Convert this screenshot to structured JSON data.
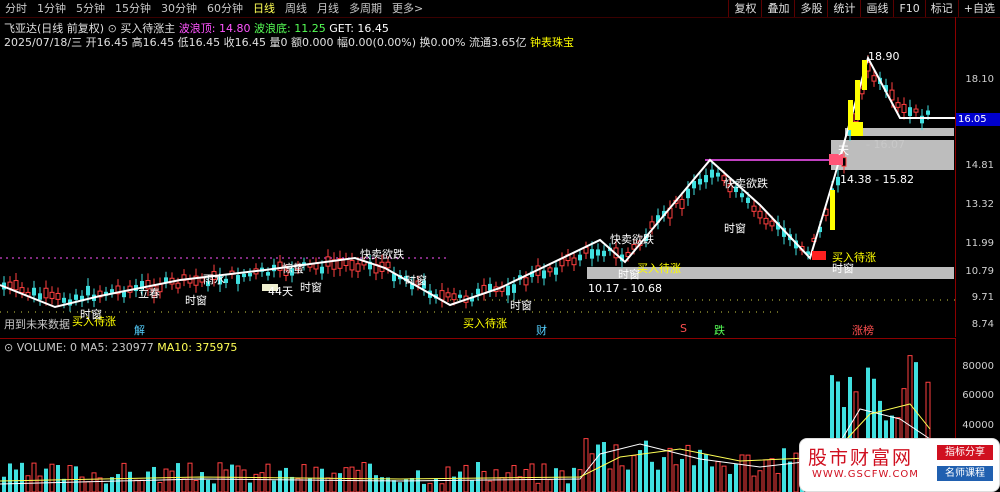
{
  "toolbar": {
    "periods": [
      "分时",
      "1分钟",
      "5分钟",
      "15分钟",
      "30分钟",
      "60分钟",
      "日线",
      "周线",
      "月线",
      "多周期",
      "更多>"
    ],
    "active_period": "日线",
    "right_buttons": [
      "复权",
      "叠加",
      "多股",
      "统计",
      "画线",
      "F10",
      "标记",
      "+自选"
    ]
  },
  "header": {
    "stock_name": "飞亚达(日线 前复权)",
    "indicator_name": "买入待涨主",
    "peak_label": "波浪顶: 14.80",
    "trough_label": "波浪底: 11.25",
    "get_label": "GET: 16.45",
    "quote": "2025/07/18/三 开16.45 高16.45 低16.45 收16.45 量0 额0.000 幅0.00(0.00%) 换0.00% 流通3.65亿",
    "tag": "钟表珠宝"
  },
  "price_axis": {
    "ticks": [
      "18.10",
      "16.05",
      "14.81",
      "13.32",
      "11.99",
      "10.79",
      "9.71",
      "8.74"
    ],
    "current": "16.05"
  },
  "volume": {
    "name": "VOLUME: 0",
    "ma5": "MA5: 230977",
    "ma10": "MA10: 375975",
    "ticks": [
      "80000",
      "60000",
      "40000"
    ]
  },
  "annotations": {
    "future": "用到未来数据",
    "signal_buy": "买入待涨",
    "signal_window": "时窗",
    "signal_sell": "快卖欲跌",
    "signal_rise": "立春",
    "signal_rain": "雨水",
    "signal_jingzhe": "惊蛰",
    "zone1": "10.17 - 10.68",
    "zone2": "14.38 - 15.82",
    "zone3": "- 16.07",
    "zone3_label": "天",
    "peak_text": "18.90",
    "mark_jie": "解",
    "mark_cai": "财",
    "mark_s": "S",
    "mark_die": "跌",
    "mark_zt": "涨榜",
    "mark_44": "44天"
  },
  "watermark": {
    "title": "股市财富网",
    "url": "WWW.GSCFW.COM",
    "tag1": "指标分享",
    "tag2": "名师课程"
  }
}
